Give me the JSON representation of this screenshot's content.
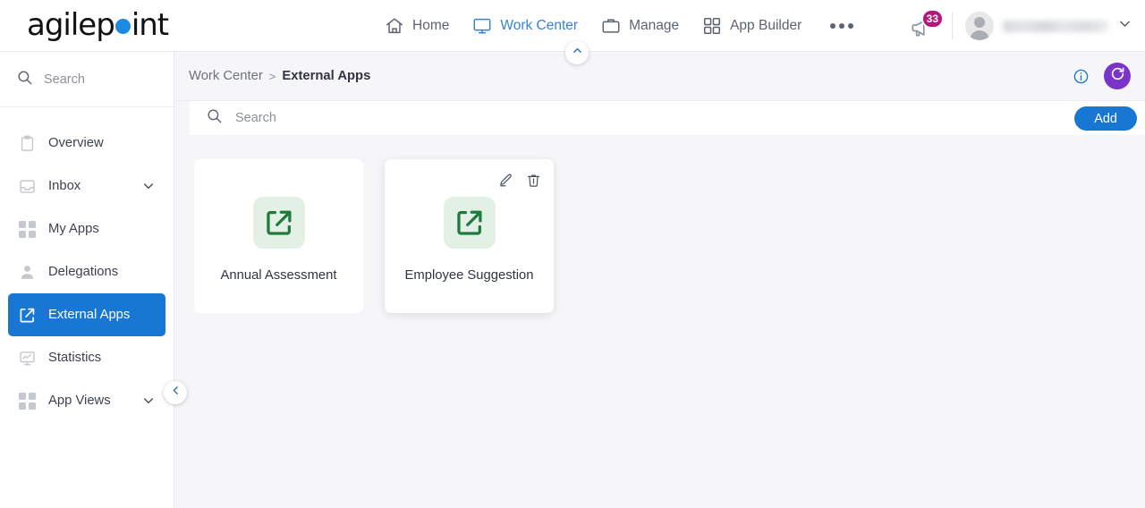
{
  "app": {
    "logo_text_before": "agilep",
    "logo_dot": "o",
    "logo_text_after": "int"
  },
  "topnav": {
    "items": [
      {
        "label": "Home",
        "icon": "home-icon",
        "active": false
      },
      {
        "label": "Work Center",
        "icon": "monitor-icon",
        "active": true
      },
      {
        "label": "Manage",
        "icon": "briefcase-icon",
        "active": false
      },
      {
        "label": "App Builder",
        "icon": "grid-icon",
        "active": false
      }
    ],
    "overflow_icon": "ellipsis-icon",
    "notifications": {
      "icon": "megaphone-icon",
      "count": "33",
      "badge_color": "#b4177e"
    },
    "user": {
      "avatar_icon": "avatar-icon",
      "name": "",
      "chevron_icon": "chevron-down-icon"
    },
    "active_color": "#3a7fd5"
  },
  "sidebar": {
    "search": {
      "icon": "search-icon",
      "placeholder": "Search",
      "value": ""
    },
    "items": [
      {
        "label": "Overview",
        "icon": "clipboard-icon",
        "expandable": false,
        "active": false
      },
      {
        "label": "Inbox",
        "icon": "inbox-icon",
        "expandable": true,
        "active": false
      },
      {
        "label": "My Apps",
        "icon": "grid-icon",
        "expandable": false,
        "active": false
      },
      {
        "label": "Delegations",
        "icon": "person-icon",
        "expandable": false,
        "active": false
      },
      {
        "label": "External Apps",
        "icon": "external-link-icon",
        "expandable": false,
        "active": true
      },
      {
        "label": "Statistics",
        "icon": "statistics-icon",
        "expandable": false,
        "active": false
      },
      {
        "label": "App Views",
        "icon": "grid-icon",
        "expandable": true,
        "active": false
      }
    ],
    "collapse_icon": "chevron-left-icon",
    "active_color": "#1877d2"
  },
  "breadcrumb": {
    "parent": "Work Center",
    "separator": ">",
    "current": "External Apps",
    "info_icon": "info-icon",
    "refresh_icon": "refresh-icon",
    "refresh_color": "#7a34c8",
    "collapse_icon": "chevron-up-icon"
  },
  "toolbar": {
    "search_icon": "search-icon",
    "search_placeholder": "Search",
    "search_value": "",
    "add_label": "Add",
    "add_color": "#1877d2"
  },
  "cards": [
    {
      "title": "Annual Assessment",
      "icon": "external-link-icon",
      "icon_color": "#1f7a3d",
      "icon_bg": "#e2f0e5",
      "hovered": false
    },
    {
      "title": "Employee Suggestion",
      "icon": "external-link-icon",
      "icon_color": "#1f7a3d",
      "icon_bg": "#e2f0e5",
      "hovered": true,
      "actions": [
        {
          "name": "edit",
          "icon": "pencil-icon"
        },
        {
          "name": "delete",
          "icon": "trash-icon"
        }
      ]
    }
  ]
}
